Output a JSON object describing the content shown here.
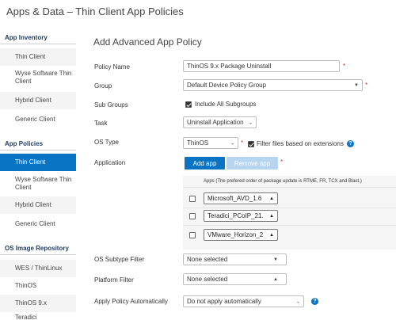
{
  "page_title": "Apps & Data – Thin Client App Policies",
  "sidebar": {
    "sections": [
      {
        "title": "App Inventory",
        "items": [
          "Thin Client",
          "Wyse Software Thin Client",
          "Hybrid Client",
          "Generic Client"
        ]
      },
      {
        "title": "App Policies",
        "items": [
          "Thin Client",
          "Wyse Software Thin Client",
          "Hybrid Client",
          "Generic Client"
        ],
        "active_index": 0
      },
      {
        "title": "OS Image Repository",
        "items": [
          "WES / ThinLinux",
          "ThinOS",
          "ThinOS 9.x",
          "Teradici"
        ]
      }
    ]
  },
  "form": {
    "title": "Add Advanced App Policy",
    "policy_name": {
      "label": "Policy Name",
      "value": "ThinOS 9.x Package Uninstall",
      "required": "*"
    },
    "group": {
      "label": "Group",
      "value": "Default Device Policy Group",
      "required": "*"
    },
    "sub_groups": {
      "label": "Sub Groups",
      "checkbox_label": "Include All Subgroups",
      "checked": true
    },
    "task": {
      "label": "Task",
      "value": "Uninstall Application"
    },
    "os_type": {
      "label": "OS Type",
      "value": "ThinOS",
      "required": "*",
      "filter_label": "Filter files based on extensions",
      "filter_checked": true
    },
    "application": {
      "label": "Application",
      "add_button": "Add app",
      "remove_button": "Remove app",
      "required": "*",
      "apps_header": "Apps (The prefered order of package update is RTME, FR, TCX and Blast.)",
      "apps": [
        "Microsoft_AVD_1.6",
        "Teradici_PCoIP_21.",
        "VMware_Horizon_2"
      ]
    },
    "os_subtype_filter": {
      "label": "OS Subtype Filter",
      "value": "None selected"
    },
    "platform_filter": {
      "label": "Platform Filter",
      "value": "None selected"
    },
    "apply_policy": {
      "label": "Apply Policy Automatically",
      "value": "Do not apply automatically"
    }
  },
  "colors": {
    "accent": "#0a74c4",
    "active_bg": "#0a74c4",
    "required": "#d9342b",
    "section_title": "#1f3a5f"
  },
  "icons": {
    "help": "question-circle-icon",
    "caret": "chevron-down-icon",
    "up": "caret-up-icon"
  }
}
